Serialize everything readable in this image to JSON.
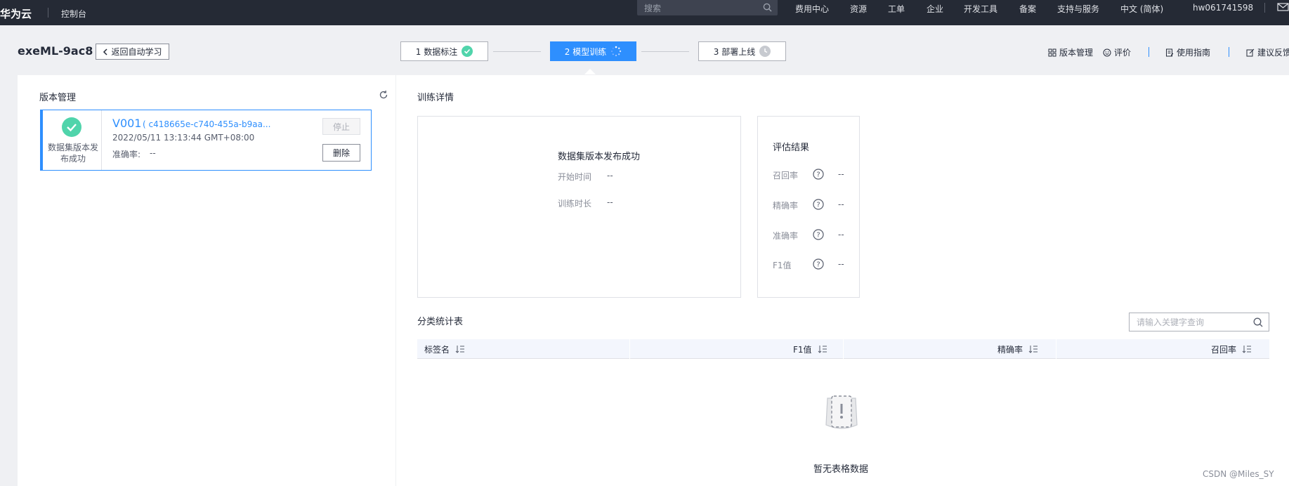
{
  "topbar": {
    "logo": "华为云",
    "console": "控制台",
    "search_placeholder": "搜索",
    "nav": [
      "费用中心",
      "资源",
      "工单",
      "企业",
      "开发工具",
      "备案",
      "支持与服务",
      "中文 (简体)",
      "hw061741598"
    ]
  },
  "header": {
    "project_title": "exeML-9ac8",
    "back_button": "返回自动学习",
    "steps": [
      {
        "label": "1 数据标注",
        "state": "done"
      },
      {
        "label": "2 模型训练",
        "state": "active"
      },
      {
        "label": "3 部署上线",
        "state": "pending"
      }
    ],
    "links": [
      "版本管理",
      "评价",
      "使用指南",
      "建议反馈"
    ]
  },
  "left_panel": {
    "title": "版本管理",
    "version": {
      "status": "数据集版本发布成功",
      "name": "V001",
      "id": "( c418665e-c740-455a-b9aa...",
      "time": "2022/05/11 13:13:44 GMT+08:00",
      "accuracy_label": "准确率:",
      "accuracy_value": "--",
      "stop_button": "停止",
      "delete_button": "删除"
    }
  },
  "details": {
    "title": "训练详情",
    "status": "数据集版本发布成功",
    "start_time_label": "开始时间",
    "start_time_value": "--",
    "duration_label": "训练时长",
    "duration_value": "--"
  },
  "evaluation": {
    "title": "评估结果",
    "metrics": [
      {
        "label": "召回率",
        "value": "--"
      },
      {
        "label": "精确率",
        "value": "--"
      },
      {
        "label": "准确率",
        "value": "--"
      },
      {
        "label": "F1值",
        "value": "--"
      }
    ]
  },
  "stats_table": {
    "title": "分类统计表",
    "search_placeholder": "请输入关键字查询",
    "columns": [
      "标签名",
      "F1值",
      "精确率",
      "召回率"
    ],
    "empty_text": "暂无表格数据"
  },
  "watermark": "CSDN @Miles_SY",
  "colors": {
    "accent": "#2e8ffe",
    "success": "#50d4ab",
    "topbar": "#252a35"
  }
}
